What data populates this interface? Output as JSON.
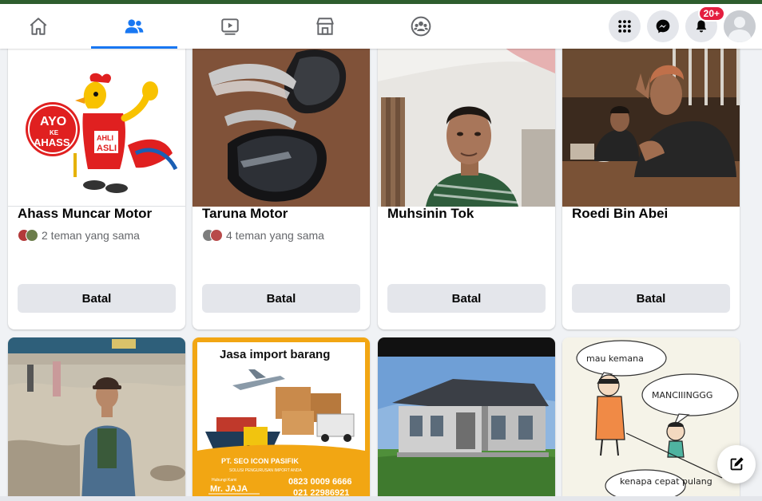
{
  "nav": {
    "tabs": [
      {
        "id": "home",
        "icon": "home-icon",
        "active": false
      },
      {
        "id": "friends",
        "icon": "friends-icon",
        "active": true
      },
      {
        "id": "watch",
        "icon": "watch-icon",
        "active": false
      },
      {
        "id": "marketplace",
        "icon": "marketplace-icon",
        "active": false
      },
      {
        "id": "groups",
        "icon": "groups-icon",
        "active": false
      }
    ],
    "notifications_badge": "20+",
    "accent_color": "#1877f2",
    "badge_color": "#e41e3f"
  },
  "cards": [
    {
      "name": "Ahass Muncar Motor",
      "mutual": "2 teman yang sama",
      "button": "Batal"
    },
    {
      "name": "Taruna Motor",
      "mutual": "4 teman yang sama",
      "button": "Batal"
    },
    {
      "name": "Muhsinin Tok",
      "mutual": "",
      "button": "Batal"
    },
    {
      "name": "Roedi Bin Abei",
      "mutual": "",
      "button": "Batal"
    }
  ],
  "photos": {
    "ahass": {
      "line1": "AYO",
      "line2": "KE",
      "line3": "AHASS",
      "shirt": "AHLI",
      "shirt2": "ASLI"
    },
    "poster": {
      "title": "Jasa import barang",
      "company": "PT. SEO ICON PASIFIK",
      "tagline": "SOLUSI PENGURUSAN IMPORT ANDA",
      "contact_label": "Hubungi Kami",
      "contact_name": "Mr. JAJA",
      "phone1": "0823 0009 6666",
      "phone2": "021 22986921"
    },
    "comic": {
      "bubble1": "mau kemana",
      "bubble2": "MANCIIINGGG",
      "bubble3": "kenapa cepat pulang"
    }
  }
}
